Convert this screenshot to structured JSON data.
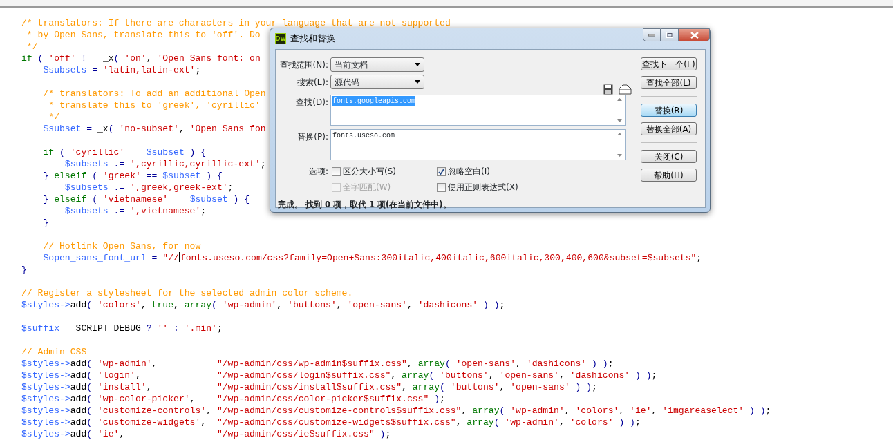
{
  "editor": {
    "lines": [
      {
        "tokens": [
          {
            "kind": "comment",
            "text": "/* translators: If there are characters in your language that are not supported"
          }
        ]
      },
      {
        "tokens": [
          {
            "kind": "comment",
            "text": " * by Open Sans, translate this to 'off'. Do"
          }
        ]
      },
      {
        "tokens": [
          {
            "kind": "comment",
            "text": " */"
          }
        ]
      },
      {
        "tokens": [
          {
            "kind": "keyword",
            "text": "if"
          },
          {
            "kind": "punct",
            "text": " ( "
          },
          {
            "kind": "string",
            "text": "'off'"
          },
          {
            "kind": "punct",
            "text": " !== "
          },
          {
            "kind": "plain",
            "text": "_x"
          },
          {
            "kind": "punct",
            "text": "( "
          },
          {
            "kind": "string",
            "text": "'on'"
          },
          {
            "kind": "plain",
            "text": ", "
          },
          {
            "kind": "string",
            "text": "'Open Sans font: on"
          }
        ]
      },
      {
        "tokens": [
          {
            "kind": "var",
            "text": "    $subsets"
          },
          {
            "kind": "punct",
            "text": " = "
          },
          {
            "kind": "string",
            "text": "'latin,latin-ext'"
          },
          {
            "kind": "plain",
            "text": ";"
          }
        ]
      },
      {
        "blank_line_before": true,
        "tokens": [
          {
            "kind": "comment",
            "text": "    /* translators: To add an additional Open"
          }
        ]
      },
      {
        "tokens": [
          {
            "kind": "comment",
            "text": "     * translate this to 'greek', 'cyrillic'"
          }
        ]
      },
      {
        "tokens": [
          {
            "kind": "comment",
            "text": "     */"
          }
        ]
      },
      {
        "tokens": [
          {
            "kind": "var",
            "text": "    $subset"
          },
          {
            "kind": "punct",
            "text": " = "
          },
          {
            "kind": "plain",
            "text": "_x"
          },
          {
            "kind": "punct",
            "text": "( "
          },
          {
            "kind": "string",
            "text": "'no-subset'"
          },
          {
            "kind": "plain",
            "text": ", "
          },
          {
            "kind": "string",
            "text": "'Open Sans fon"
          }
        ]
      },
      {
        "blank_line_before": true,
        "tokens": [
          {
            "kind": "keyword",
            "text": "    if"
          },
          {
            "kind": "punct",
            "text": " ( "
          },
          {
            "kind": "string",
            "text": "'cyrillic'"
          },
          {
            "kind": "punct",
            "text": " == "
          },
          {
            "kind": "var",
            "text": "$subset"
          },
          {
            "kind": "punct",
            "text": " ) {"
          }
        ]
      },
      {
        "tokens": [
          {
            "kind": "var",
            "text": "        $subsets"
          },
          {
            "kind": "punct",
            "text": " .= "
          },
          {
            "kind": "string",
            "text": "',cyrillic,cyrillic-ext'"
          },
          {
            "kind": "plain",
            "text": ";"
          }
        ]
      },
      {
        "tokens": [
          {
            "kind": "punct",
            "text": "    } "
          },
          {
            "kind": "keyword",
            "text": "elseif"
          },
          {
            "kind": "punct",
            "text": " ( "
          },
          {
            "kind": "string",
            "text": "'greek'"
          },
          {
            "kind": "punct",
            "text": " == "
          },
          {
            "kind": "var",
            "text": "$subset"
          },
          {
            "kind": "punct",
            "text": " ) {"
          }
        ]
      },
      {
        "tokens": [
          {
            "kind": "var",
            "text": "        $subsets"
          },
          {
            "kind": "punct",
            "text": " .= "
          },
          {
            "kind": "string",
            "text": "',greek,greek-ext'"
          },
          {
            "kind": "plain",
            "text": ";"
          }
        ]
      },
      {
        "tokens": [
          {
            "kind": "punct",
            "text": "    } "
          },
          {
            "kind": "keyword",
            "text": "elseif"
          },
          {
            "kind": "punct",
            "text": " ( "
          },
          {
            "kind": "string",
            "text": "'vietnamese'"
          },
          {
            "kind": "punct",
            "text": " == "
          },
          {
            "kind": "var",
            "text": "$subset"
          },
          {
            "kind": "punct",
            "text": " ) {"
          }
        ]
      },
      {
        "tokens": [
          {
            "kind": "var",
            "text": "        $subsets"
          },
          {
            "kind": "punct",
            "text": " .= "
          },
          {
            "kind": "string",
            "text": "',vietnamese'"
          },
          {
            "kind": "plain",
            "text": ";"
          }
        ]
      },
      {
        "tokens": [
          {
            "kind": "punct",
            "text": "    }"
          }
        ]
      },
      {
        "blank_line_before": true,
        "tokens": [
          {
            "kind": "comment",
            "text": "    // Hotlink Open Sans, for now"
          }
        ]
      },
      {
        "tokens": [
          {
            "kind": "var",
            "text": "    $open_sans_font_url"
          },
          {
            "kind": "punct",
            "text": " = "
          },
          {
            "kind": "string",
            "text": "\"//"
          },
          {
            "kind": "caret"
          },
          {
            "kind": "string",
            "text": "fonts.useso.com/css?family=Open+Sans:300italic,400italic,600italic,300,400,600&subset=$subsets\""
          },
          {
            "kind": "plain",
            "text": ";"
          }
        ]
      },
      {
        "tokens": [
          {
            "kind": "punct",
            "text": "}"
          }
        ]
      },
      {
        "blank_line_before": true,
        "tokens": [
          {
            "kind": "comment",
            "text": "// Register a stylesheet for the selected admin color scheme."
          }
        ]
      },
      {
        "tokens": [
          {
            "kind": "var",
            "text": "$styles->"
          },
          {
            "kind": "plain",
            "text": "add"
          },
          {
            "kind": "punct",
            "text": "( "
          },
          {
            "kind": "string",
            "text": "'colors'"
          },
          {
            "kind": "plain",
            "text": ", "
          },
          {
            "kind": "keyword",
            "text": "true"
          },
          {
            "kind": "plain",
            "text": ", "
          },
          {
            "kind": "keyword",
            "text": "array"
          },
          {
            "kind": "punct",
            "text": "( "
          },
          {
            "kind": "string",
            "text": "'wp-admin'"
          },
          {
            "kind": "plain",
            "text": ", "
          },
          {
            "kind": "string",
            "text": "'buttons'"
          },
          {
            "kind": "plain",
            "text": ", "
          },
          {
            "kind": "string",
            "text": "'open-sans'"
          },
          {
            "kind": "plain",
            "text": ", "
          },
          {
            "kind": "string",
            "text": "'dashicons'"
          },
          {
            "kind": "punct",
            "text": " ) )"
          },
          {
            "kind": "plain",
            "text": ";"
          }
        ]
      },
      {
        "blank_line_before": true,
        "tokens": [
          {
            "kind": "var",
            "text": "$suffix"
          },
          {
            "kind": "punct",
            "text": " = "
          },
          {
            "kind": "plain",
            "text": "SCRIPT_DEBUG "
          },
          {
            "kind": "punct",
            "text": "? "
          },
          {
            "kind": "string",
            "text": "''"
          },
          {
            "kind": "punct",
            "text": " : "
          },
          {
            "kind": "string",
            "text": "'.min'"
          },
          {
            "kind": "plain",
            "text": ";"
          }
        ]
      },
      {
        "blank_line_before": true,
        "tokens": [
          {
            "kind": "comment",
            "text": "// Admin CSS"
          }
        ]
      },
      {
        "tokens": [
          {
            "kind": "var",
            "text": "$styles->"
          },
          {
            "kind": "plain",
            "text": "add"
          },
          {
            "kind": "punct",
            "text": "( "
          },
          {
            "kind": "string",
            "text": "'wp-admin'"
          },
          {
            "kind": "plain",
            "text": ",           "
          },
          {
            "kind": "string",
            "text": "\"/wp-admin/css/wp-admin$suffix.css\""
          },
          {
            "kind": "plain",
            "text": ", "
          },
          {
            "kind": "keyword",
            "text": "array"
          },
          {
            "kind": "punct",
            "text": "( "
          },
          {
            "kind": "string",
            "text": "'open-sans'"
          },
          {
            "kind": "plain",
            "text": ", "
          },
          {
            "kind": "string",
            "text": "'dashicons'"
          },
          {
            "kind": "punct",
            "text": " ) )"
          },
          {
            "kind": "plain",
            "text": ";"
          }
        ]
      },
      {
        "tokens": [
          {
            "kind": "var",
            "text": "$styles->"
          },
          {
            "kind": "plain",
            "text": "add"
          },
          {
            "kind": "punct",
            "text": "( "
          },
          {
            "kind": "string",
            "text": "'login'"
          },
          {
            "kind": "plain",
            "text": ",              "
          },
          {
            "kind": "string",
            "text": "\"/wp-admin/css/login$suffix.css\""
          },
          {
            "kind": "plain",
            "text": ", "
          },
          {
            "kind": "keyword",
            "text": "array"
          },
          {
            "kind": "punct",
            "text": "( "
          },
          {
            "kind": "string",
            "text": "'buttons'"
          },
          {
            "kind": "plain",
            "text": ", "
          },
          {
            "kind": "string",
            "text": "'open-sans'"
          },
          {
            "kind": "plain",
            "text": ", "
          },
          {
            "kind": "string",
            "text": "'dashicons'"
          },
          {
            "kind": "punct",
            "text": " ) )"
          },
          {
            "kind": "plain",
            "text": ";"
          }
        ]
      },
      {
        "tokens": [
          {
            "kind": "var",
            "text": "$styles->"
          },
          {
            "kind": "plain",
            "text": "add"
          },
          {
            "kind": "punct",
            "text": "( "
          },
          {
            "kind": "string",
            "text": "'install'"
          },
          {
            "kind": "plain",
            "text": ",            "
          },
          {
            "kind": "string",
            "text": "\"/wp-admin/css/install$suffix.css\""
          },
          {
            "kind": "plain",
            "text": ", "
          },
          {
            "kind": "keyword",
            "text": "array"
          },
          {
            "kind": "punct",
            "text": "( "
          },
          {
            "kind": "string",
            "text": "'buttons'"
          },
          {
            "kind": "plain",
            "text": ", "
          },
          {
            "kind": "string",
            "text": "'open-sans'"
          },
          {
            "kind": "punct",
            "text": " ) )"
          },
          {
            "kind": "plain",
            "text": ";"
          }
        ]
      },
      {
        "tokens": [
          {
            "kind": "var",
            "text": "$styles->"
          },
          {
            "kind": "plain",
            "text": "add"
          },
          {
            "kind": "punct",
            "text": "( "
          },
          {
            "kind": "string",
            "text": "'wp-color-picker'"
          },
          {
            "kind": "plain",
            "text": ",    "
          },
          {
            "kind": "string",
            "text": "\"/wp-admin/css/color-picker$suffix.css\""
          },
          {
            "kind": "punct",
            "text": " )"
          },
          {
            "kind": "plain",
            "text": ";"
          }
        ]
      },
      {
        "tokens": [
          {
            "kind": "var",
            "text": "$styles->"
          },
          {
            "kind": "plain",
            "text": "add"
          },
          {
            "kind": "punct",
            "text": "( "
          },
          {
            "kind": "string",
            "text": "'customize-controls'"
          },
          {
            "kind": "plain",
            "text": ", "
          },
          {
            "kind": "string",
            "text": "\"/wp-admin/css/customize-controls$suffix.css\""
          },
          {
            "kind": "plain",
            "text": ", "
          },
          {
            "kind": "keyword",
            "text": "array"
          },
          {
            "kind": "punct",
            "text": "( "
          },
          {
            "kind": "string",
            "text": "'wp-admin'"
          },
          {
            "kind": "plain",
            "text": ", "
          },
          {
            "kind": "string",
            "text": "'colors'"
          },
          {
            "kind": "plain",
            "text": ", "
          },
          {
            "kind": "string",
            "text": "'ie'"
          },
          {
            "kind": "plain",
            "text": ", "
          },
          {
            "kind": "string",
            "text": "'imgareaselect'"
          },
          {
            "kind": "punct",
            "text": " ) )"
          },
          {
            "kind": "plain",
            "text": ";"
          }
        ]
      },
      {
        "tokens": [
          {
            "kind": "var",
            "text": "$styles->"
          },
          {
            "kind": "plain",
            "text": "add"
          },
          {
            "kind": "punct",
            "text": "( "
          },
          {
            "kind": "string",
            "text": "'customize-widgets'"
          },
          {
            "kind": "plain",
            "text": ",  "
          },
          {
            "kind": "string",
            "text": "\"/wp-admin/css/customize-widgets$suffix.css\""
          },
          {
            "kind": "plain",
            "text": ", "
          },
          {
            "kind": "keyword",
            "text": "array"
          },
          {
            "kind": "punct",
            "text": "( "
          },
          {
            "kind": "string",
            "text": "'wp-admin'"
          },
          {
            "kind": "plain",
            "text": ", "
          },
          {
            "kind": "string",
            "text": "'colors'"
          },
          {
            "kind": "punct",
            "text": " ) )"
          },
          {
            "kind": "plain",
            "text": ";"
          }
        ]
      },
      {
        "tokens": [
          {
            "kind": "var",
            "text": "$styles->"
          },
          {
            "kind": "plain",
            "text": "add"
          },
          {
            "kind": "punct",
            "text": "( "
          },
          {
            "kind": "string",
            "text": "'ie'"
          },
          {
            "kind": "plain",
            "text": ",                 "
          },
          {
            "kind": "string",
            "text": "\"/wp-admin/css/ie$suffix.css\""
          },
          {
            "kind": "punct",
            "text": " )"
          },
          {
            "kind": "plain",
            "text": ";"
          }
        ]
      }
    ]
  },
  "dialog": {
    "app_icon_text": "Dw",
    "title": "查找和替换",
    "scope": {
      "label": "查找范围(N):",
      "value": "当前文档"
    },
    "search_in": {
      "label": "搜索(E):",
      "value": "源代码"
    },
    "find": {
      "label": "查找(D):",
      "value": "fonts.googleapis.com",
      "text_selected": true
    },
    "replace": {
      "label": "替换(P):",
      "value": "fonts.useso.com"
    },
    "options_label": "选项:",
    "options": [
      {
        "label": "区分大小写(S)",
        "checked": false,
        "disabled": false
      },
      {
        "label": "忽略空白(I)",
        "checked": true,
        "disabled": false
      },
      {
        "label": "全字匹配(W)",
        "checked": false,
        "disabled": true
      },
      {
        "label": "使用正则表达式(X)",
        "checked": false,
        "disabled": false
      }
    ],
    "status": "完成。 找到 0 项，取代 1 项(在当前文件中)。",
    "buttons": [
      {
        "label": "查找下一个(F)",
        "default": false,
        "separator_before": false
      },
      {
        "label": "查找全部(L)",
        "default": false,
        "separator_before": false
      },
      {
        "label": "替换(R)",
        "default": true,
        "separator_before": true
      },
      {
        "label": "替换全部(A)",
        "default": false,
        "separator_before": false
      },
      {
        "label": "关闭(C)",
        "default": false,
        "separator_before": true
      },
      {
        "label": "帮助(H)",
        "default": false,
        "separator_before": false
      }
    ]
  }
}
